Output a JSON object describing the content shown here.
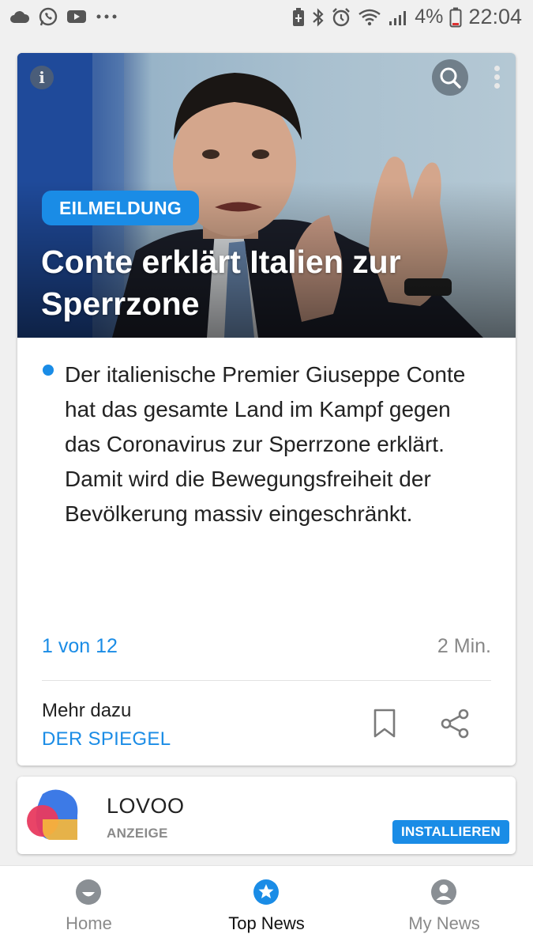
{
  "status_bar": {
    "battery": "4%",
    "time": "22:04"
  },
  "article": {
    "badge": "EILMELDUNG",
    "headline": "Conte erklärt Italien zur Sperrzone",
    "summary": "Der italienische Premier Giuseppe Conte hat das gesamte Land im Kampf gegen das Coronavirus zur Sperrzone erklärt. Damit wird die Bewegungsfreiheit der Bevölkerung massiv eingeschränkt.",
    "pager": "1 von 12",
    "read_time": "2 Min.",
    "more_label": "Mehr dazu",
    "source": "DER SPIEGEL"
  },
  "ad": {
    "name": "LOVOO",
    "label": "ANZEIGE",
    "cta": "INSTALLIEREN"
  },
  "bottom_nav": {
    "items": [
      {
        "label": "Home",
        "icon": "smiley-icon"
      },
      {
        "label": "Top News",
        "icon": "star-icon"
      },
      {
        "label": "My News",
        "icon": "person-icon"
      }
    ],
    "active": "Top News"
  },
  "colors": {
    "accent": "#1a8ce6",
    "muted": "#8a8a8a"
  }
}
